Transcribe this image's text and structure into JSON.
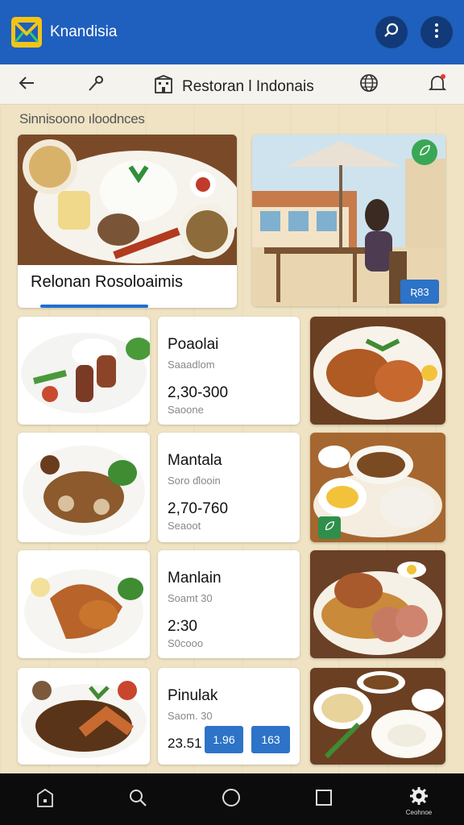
{
  "app": {
    "title": "Knandisia"
  },
  "toolbar": {
    "title": "Restoran l Indonais"
  },
  "section_heading": "Sinnisoono ıloodnces",
  "featured": {
    "label": "Relonan Rosoloaimis",
    "badge": "Ʀ83"
  },
  "items": [
    {
      "name": "Poaolai",
      "sub": "Saaadlom",
      "price": "2,30-300",
      "small": "Saoone"
    },
    {
      "name": "Mantala",
      "sub": "Soro ɗlooin",
      "price": "2,70-760",
      "small": "Seaoot"
    },
    {
      "name": "Manlain",
      "sub": "Soamt 30",
      "price": "2:30",
      "small": "S0cooo"
    },
    {
      "name": "Pinulak",
      "sub": "Saom. 30",
      "price": "23.51",
      "chips": [
        "1.96",
        "163"
      ]
    }
  ],
  "nav": {
    "settings_label": "Ceohnoe"
  },
  "colors": {
    "appbar": "#1f5fbd",
    "accent": "#2d73c8",
    "background": "#efe3c4",
    "navbar": "#0c0c0c"
  },
  "icons": [
    "logo-icon",
    "search-icon",
    "more-vert-icon",
    "back-icon",
    "wand-icon",
    "building-icon",
    "globe-icon",
    "bell-icon",
    "home-icon",
    "circle-icon",
    "square-icon",
    "gear-icon",
    "leaf-icon"
  ]
}
